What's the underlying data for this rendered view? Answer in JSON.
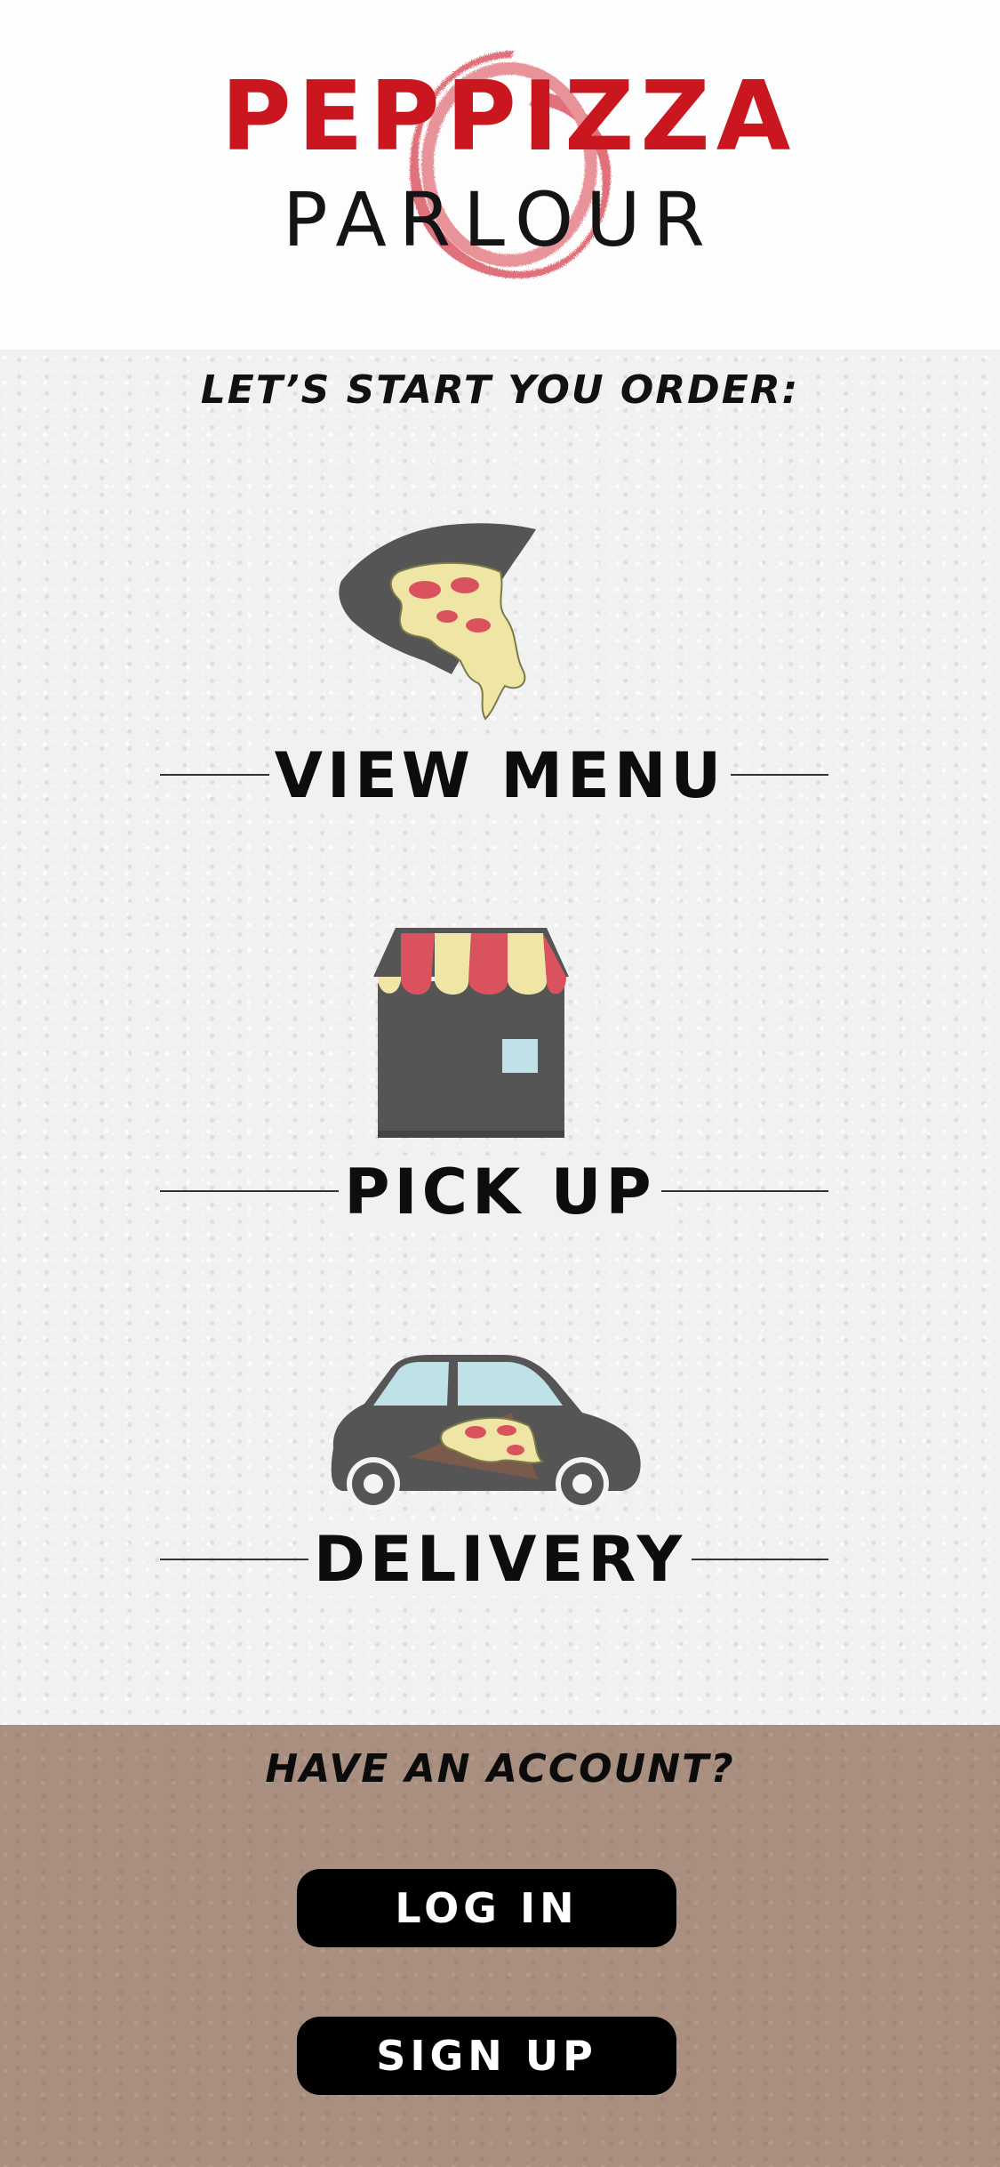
{
  "brand": {
    "name_line1": "PEPPIZZA",
    "name_line2": "PARLOUR",
    "primary_color": "#c9161f"
  },
  "order": {
    "prompt": "LET’S START YOU ORDER:",
    "options": [
      {
        "label": "VIEW MENU",
        "icon": "pizza-slice-icon"
      },
      {
        "label": "PICK UP",
        "icon": "storefront-icon"
      },
      {
        "label": "DELIVERY",
        "icon": "delivery-car-icon"
      }
    ]
  },
  "account": {
    "title": "HAVE AN ACCOUNT?",
    "login_label": "LOG IN",
    "signup_label": "SIGN UP",
    "background_color": "#a88f7f"
  },
  "colors": {
    "icon_dark": "#555555",
    "cheese": "#efe6a6",
    "pepperoni": "#d9525e",
    "glass": "#bfe1e8"
  }
}
